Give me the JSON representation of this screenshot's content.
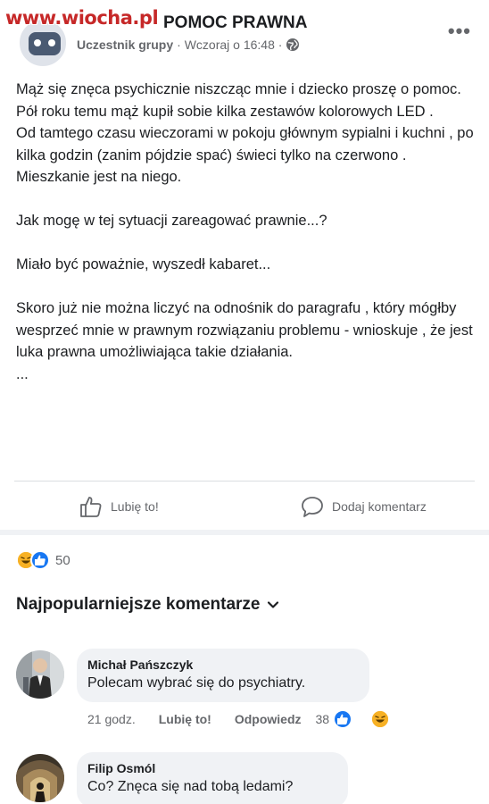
{
  "watermark": "www.wiocha.pl",
  "post": {
    "group_name": "POMOC PRAWNA",
    "role": "Uczestnik grupy",
    "time": "· Wczoraj o 16:48 ·",
    "paragraphs": [
      "Mąż się znęca psychicznie niszcząc mnie i dziecko proszę o pomoc.",
      "Pół roku temu mąż kupił sobie kilka zestawów kolorowych LED .",
      "Od tamtego czasu wieczorami w pokoju głównym sypialni i kuchni , po kilka godzin (zanim pójdzie spać) świeci tylko na czerwono .",
      "Mieszkanie jest na niego.",
      "",
      "Jak mogę w tej sytuacji zareagować prawnie...?",
      "",
      "Miało być poważnie, wyszedł kabaret...",
      "",
      "Skoro już nie można liczyć na odnośnik do paragrafu , który mógłby wesprzeć mnie w prawnym rozwiązaniu problemu - wnioskuje , że jest luka prawna umożliwiająca takie działania.",
      "..."
    ]
  },
  "actions": {
    "like_label": "Lubię to!",
    "comment_label": "Dodaj komentarz"
  },
  "reactions": {
    "count": "50"
  },
  "comments_header": {
    "sort_label": "Najpopularniejsze komentarze"
  },
  "comments": [
    {
      "author": "Michał Pańszczyk",
      "text": "Polecam wybrać się do psychiatry.",
      "time": "21 godz.",
      "like": "Lubię to!",
      "reply": "Odpowiedz",
      "reaction_count": "38"
    },
    {
      "author": "Filip Osmól",
      "text": "Co? Znęca się nad tobą ledami?"
    }
  ],
  "colors": {
    "text": "#1c1e21",
    "secondary": "#65676b",
    "bubble": "#f0f2f5",
    "like_blue": "#1877f2",
    "haha_yellow": "#f7b125"
  }
}
